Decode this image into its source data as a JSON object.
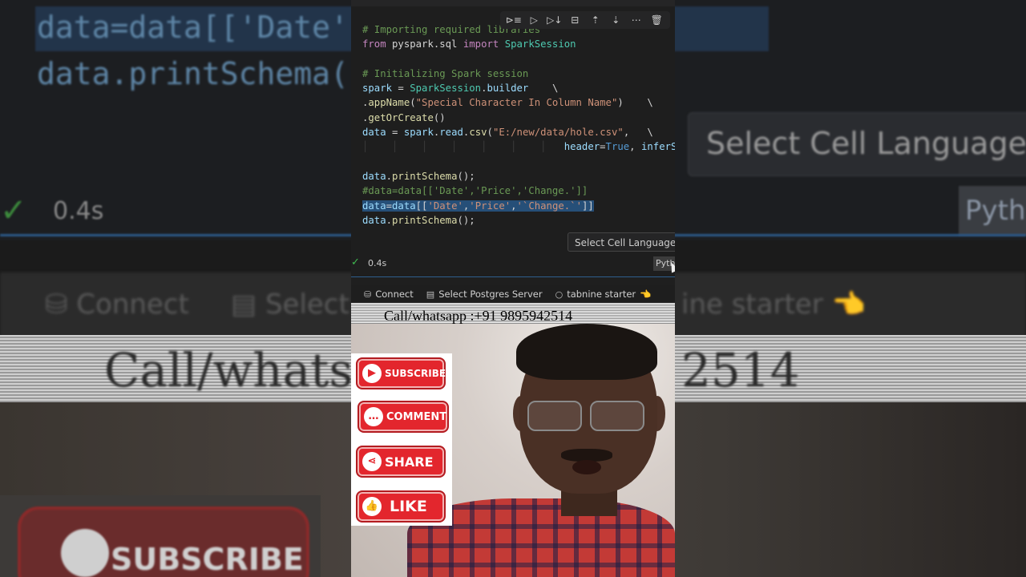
{
  "code_lines": [
    {
      "id": "comment1",
      "parts": [
        [
          "# Importing required libraries",
          "c-cmt"
        ]
      ]
    },
    {
      "id": "import",
      "parts": [
        [
          "from",
          "c-kw"
        ],
        [
          " pyspark.sql ",
          ""
        ],
        [
          "import",
          "c-kw"
        ],
        [
          " SparkSession",
          "c-cls"
        ]
      ]
    },
    {
      "id": "blank1",
      "parts": [
        [
          "",
          ""
        ]
      ]
    },
    {
      "id": "comment2",
      "parts": [
        [
          "# Initializing Spark session",
          "c-cmt"
        ]
      ]
    },
    {
      "id": "spark",
      "parts": [
        [
          "spark",
          "c-var"
        ],
        [
          " = ",
          ""
        ],
        [
          "SparkSession",
          "c-cls"
        ],
        [
          ".",
          ""
        ],
        [
          "builder",
          "c-var"
        ],
        [
          "    \\",
          ""
        ]
      ]
    },
    {
      "id": "appname",
      "parts": [
        [
          ".",
          ""
        ],
        [
          "appName",
          "c-fn"
        ],
        [
          "(",
          ""
        ],
        [
          "\"Special Character In Column Name\"",
          "c-str"
        ],
        [
          ")    \\",
          ""
        ]
      ]
    },
    {
      "id": "getorcreate",
      "parts": [
        [
          ".",
          ""
        ],
        [
          "getOrCreate",
          "c-fn"
        ],
        [
          "()",
          ""
        ]
      ]
    },
    {
      "id": "readcsv",
      "parts": [
        [
          "data",
          "c-var"
        ],
        [
          " = ",
          ""
        ],
        [
          "spark",
          "c-var"
        ],
        [
          ".",
          ""
        ],
        [
          "read",
          "c-var"
        ],
        [
          ".",
          ""
        ],
        [
          "csv",
          "c-fn"
        ],
        [
          "(",
          ""
        ],
        [
          "\"E:/new/data/hole.csv\"",
          "c-str"
        ],
        [
          ",   \\",
          ""
        ]
      ]
    },
    {
      "id": "header",
      "parts": [
        [
          "│    │    │    │    │    │    │   ",
          "guide"
        ],
        [
          "header",
          "c-var"
        ],
        [
          "=",
          ""
        ],
        [
          "True",
          "c-bool"
        ],
        [
          ", ",
          ""
        ],
        [
          "inferSchema",
          "c-var"
        ],
        [
          "=",
          ""
        ],
        [
          "True",
          "c-bool"
        ],
        [
          ")",
          ""
        ]
      ]
    },
    {
      "id": "blank2",
      "parts": [
        [
          "",
          ""
        ]
      ]
    },
    {
      "id": "print1",
      "parts": [
        [
          "data",
          "c-var"
        ],
        [
          ".",
          ""
        ],
        [
          "printSchema",
          "c-fn"
        ],
        [
          "();",
          ""
        ]
      ]
    },
    {
      "id": "commented",
      "parts": [
        [
          "#data=data[['Date','Price','Change.']]",
          "c-cmt"
        ]
      ]
    },
    {
      "id": "selected",
      "highlight": true,
      "parts": [
        [
          "data",
          "c-var"
        ],
        [
          "=",
          ""
        ],
        [
          "data",
          "c-var"
        ],
        [
          "[[",
          ""
        ],
        [
          "'Date'",
          "c-str"
        ],
        [
          ",",
          ""
        ],
        [
          "'Price'",
          "c-str"
        ],
        [
          ",",
          ""
        ],
        [
          "'`Change.`'",
          "c-str"
        ],
        [
          "]]",
          ""
        ]
      ]
    },
    {
      "id": "print2",
      "parts": [
        [
          "data",
          "c-var"
        ],
        [
          ".",
          ""
        ],
        [
          "printSchema",
          "c-fn"
        ],
        [
          "();",
          ""
        ]
      ]
    }
  ],
  "toolbar": {
    "icons": [
      "run-by-line-icon",
      "execute-above-icon",
      "execute-below-icon",
      "split-cell-icon",
      "move-up-icon",
      "move-down-icon",
      "more-icon",
      "delete-icon"
    ]
  },
  "tooltip": "Select Cell Language Mode",
  "cell_status": {
    "time": "0.4s",
    "language": "Python"
  },
  "statusbar": {
    "connect": "Connect",
    "postgres": "Select Postgres Server",
    "tabnine": "tabnine starter"
  },
  "overlay": {
    "phone": "Call/whatsapp :+91 9895942514"
  },
  "social": {
    "subscribe": "SUBSCRIBE",
    "comment": "COMMENT",
    "share": "SHARE",
    "like": "LIKE"
  },
  "background": {
    "code1": "data=data[['Date'",
    "code1b": ".`']]",
    "code2": "data.printSchema(",
    "time": "0.4s",
    "select": "Select Cell Language M",
    "pyth": "Pyth",
    "connect": "Connect",
    "select2": "Select",
    "starter": "ine starter",
    "phone_left": "Call/whatsa",
    "phone_right": "2514",
    "subscribe": "SUBSCRIBE"
  },
  "colors": {
    "accent_red": "#e3262d",
    "vscode_blue": "#264f78",
    "bg": "#1e1e1e"
  }
}
